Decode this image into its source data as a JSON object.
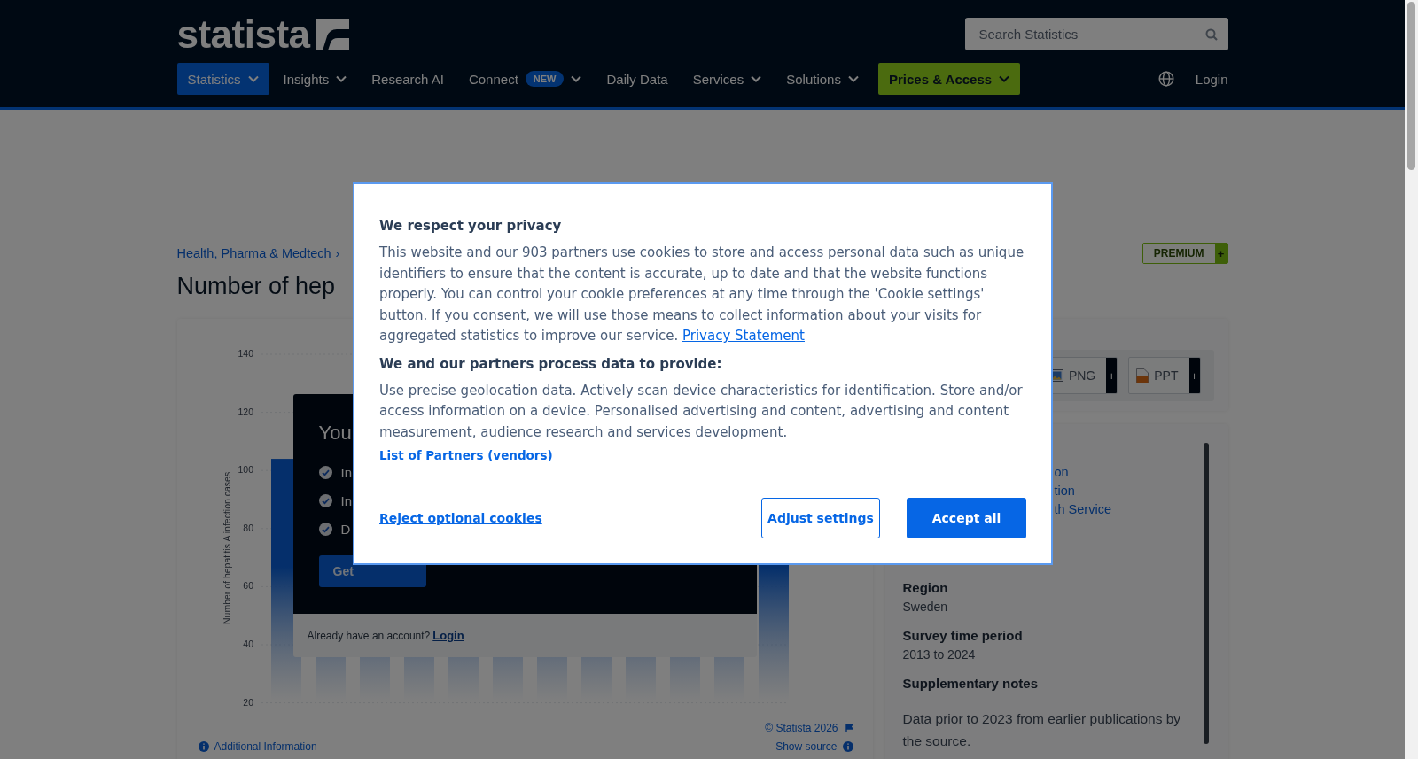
{
  "header": {
    "logo": "statista",
    "search": {
      "placeholder": "Search Statistics"
    },
    "nav": [
      {
        "label": "Statistics",
        "kind": "menu",
        "selected": true,
        "dropdown": true
      },
      {
        "label": "Insights",
        "kind": "menu",
        "selected": false,
        "dropdown": true
      },
      {
        "label": "Research AI",
        "kind": "menu",
        "selected": false,
        "dropdown": false
      },
      {
        "label": "Connect",
        "kind": "menu",
        "selected": false,
        "dropdown": true,
        "badge": "NEW"
      },
      {
        "label": "Daily Data",
        "kind": "menu",
        "selected": false,
        "dropdown": false
      },
      {
        "label": "Services",
        "kind": "menu",
        "selected": false,
        "dropdown": true
      },
      {
        "label": "Solutions",
        "kind": "menu",
        "selected": false,
        "dropdown": true
      },
      {
        "label": "Prices & Access",
        "kind": "cta",
        "selected": false,
        "dropdown": true
      }
    ],
    "login": "Login"
  },
  "breadcrumb": {
    "item": "Health, Pharma & Medtech",
    "separator": "›"
  },
  "title": "Number of hep",
  "premium": {
    "label": "PREMIUM",
    "plus": "+"
  },
  "chart_panel": {
    "chart_data": {
      "type": "bar",
      "grid": true,
      "ylim": [
        0,
        140
      ],
      "ylabel": "Number of hepatitis A infection cases",
      "yticks": [
        20,
        40,
        60,
        80,
        100,
        120,
        140
      ],
      "values": [
        104,
        null,
        null,
        null,
        null,
        null,
        null,
        null,
        null,
        null,
        null,
        null
      ]
    },
    "promo": {
      "heading": "You",
      "features": [
        "In",
        "In",
        "D"
      ],
      "button": "Get",
      "account_prompt": "Already have an account?",
      "login": "Login"
    },
    "copyright": "© Statista 2026",
    "additional_info": "Additional Information",
    "show_source": "Show source"
  },
  "tools": [
    {
      "label": "PNG",
      "plus": "+",
      "kind": "png"
    },
    {
      "label": "PPT",
      "plus": "+",
      "kind": "ppt"
    }
  ],
  "details": {
    "links": [
      "on",
      "tion",
      "th Service"
    ],
    "fields": [
      {
        "label": "Region",
        "value": "Sweden"
      },
      {
        "label": "Survey time period",
        "value": "2013 to 2024"
      },
      {
        "label": "Supplementary notes",
        "value": "Data prior to 2023 from earlier publications by the source."
      }
    ]
  },
  "consent": {
    "title": "We respect your privacy",
    "text": "This website and our 903 partners use cookies to store and access personal data such as unique identifiers to ensure that the content is accurate, up to date and that the website functions properly. You can control your cookie preferences at any time through the 'Cookie settings' button. If you consent, we will use those means to collect information about your visits for aggregated statistics to improve our service.",
    "privacy_link": "Privacy Statement",
    "subtitle": "We and our partners process data to provide:",
    "purposes": "Use precise geolocation data. Actively scan device characteristics for identification. Store and/or access information on a device. Personalised advertising and content, advertising and content measurement, audience research and services development.",
    "partners_link": "List of Partners (vendors)",
    "reject": "Reject optional cookies",
    "adjust": "Adjust settings",
    "accept": "Accept all"
  }
}
